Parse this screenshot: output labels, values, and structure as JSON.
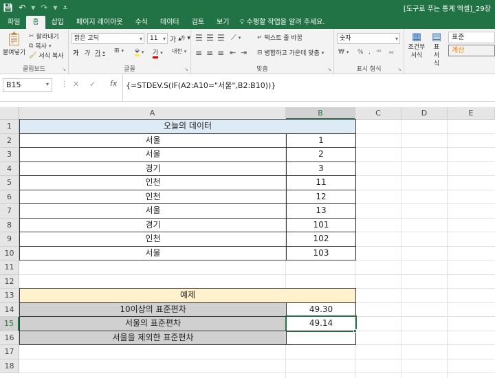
{
  "window": {
    "title": "[도구로 푸는 통계 엑셀]_29장"
  },
  "quick_access": {
    "save_icon": "save-icon",
    "undo_icon": "undo-icon",
    "redo_icon": "redo-icon"
  },
  "ribbon_tabs": [
    {
      "label": "파일"
    },
    {
      "label": "홈"
    },
    {
      "label": "삽입"
    },
    {
      "label": "페이지 레이아웃"
    },
    {
      "label": "수식"
    },
    {
      "label": "데이터"
    },
    {
      "label": "검토"
    },
    {
      "label": "보기"
    }
  ],
  "tell_me": "수행할 작업을 알려 주세요.",
  "clipboard": {
    "paste": "붙여넣기",
    "cut": "잘라내기",
    "copy": "복사",
    "format_painter": "서식 복사",
    "group": "클립보드"
  },
  "font": {
    "name": "맑은 고딕",
    "size": "11",
    "bold": "가",
    "italic": "가",
    "underline": "가",
    "grow": "가",
    "shrink": "가",
    "font_color": "가",
    "phonetic": "내천",
    "group": "글꼴"
  },
  "alignment": {
    "wrap": "텍스트 줄 바꿈",
    "merge": "병합하고 가운데 맞춤",
    "group": "맞춤"
  },
  "number": {
    "format": "숫자",
    "group": "표시 형식"
  },
  "styles": {
    "conditional": "조건부 서식",
    "table": "표 서식",
    "normal": "표준",
    "calc": "계산"
  },
  "formula_bar": {
    "name_box": "B15",
    "formula": "{=STDEV.S(IF(A2:A10=\"서울\",B2:B10))}"
  },
  "columns": [
    "A",
    "B",
    "C",
    "D",
    "E"
  ],
  "rows": [
    "1",
    "2",
    "3",
    "4",
    "5",
    "6",
    "7",
    "8",
    "9",
    "10",
    "11",
    "12",
    "13",
    "14",
    "15",
    "16",
    "17",
    "18"
  ],
  "sheet": {
    "table_header": "오늘의 데이터",
    "data": [
      {
        "region": "서울",
        "value": "1"
      },
      {
        "region": "서울",
        "value": "2"
      },
      {
        "region": "경기",
        "value": "3"
      },
      {
        "region": "인천",
        "value": "11"
      },
      {
        "region": "인천",
        "value": "12"
      },
      {
        "region": "서울",
        "value": "13"
      },
      {
        "region": "경기",
        "value": "101"
      },
      {
        "region": "인천",
        "value": "102"
      },
      {
        "region": "서울",
        "value": "103"
      }
    ],
    "example_header": "예제",
    "examples": [
      {
        "label": "10이상의 표준편차",
        "value": "49.30"
      },
      {
        "label": "서울의 표준편차",
        "value": "49.14"
      },
      {
        "label": "서울을 제외한 표준편차",
        "value": ""
      }
    ]
  }
}
